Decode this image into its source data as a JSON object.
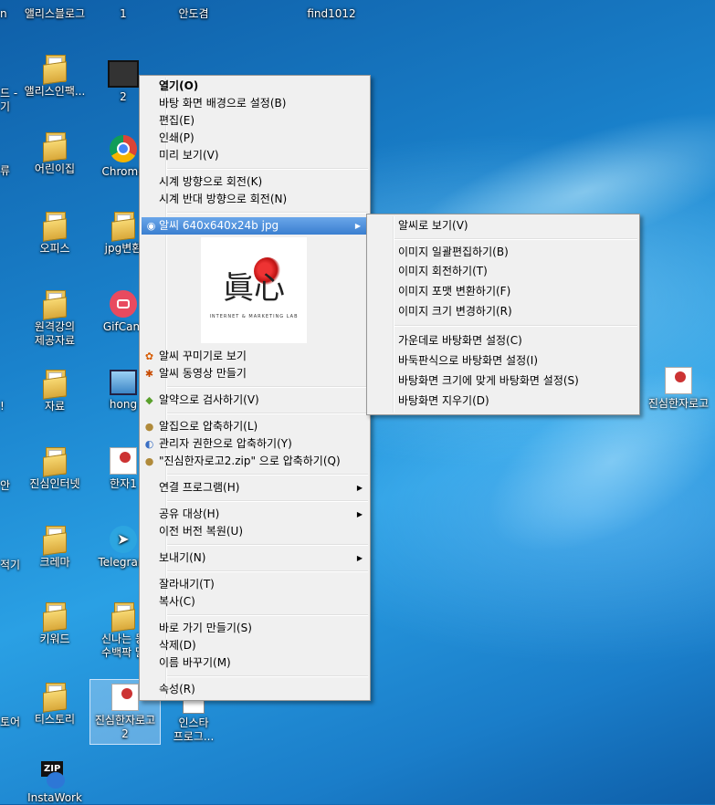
{
  "desktop": {
    "icons": [
      {
        "label": "n",
        "x": 0
      },
      {
        "label": "앨리스블로그"
      },
      {
        "label": "1"
      },
      {
        "label": "안도겸"
      },
      {
        "label": "find1012"
      },
      {
        "label": "드 -"
      },
      {
        "label": "기"
      },
      {
        "label": "앨리스인팩..."
      },
      {
        "label": "2"
      },
      {
        "label": "류"
      },
      {
        "label": "어린이집"
      },
      {
        "label": "Chrome"
      },
      {
        "label": "오피스"
      },
      {
        "label": "jpg변환"
      },
      {
        "label": "원격강의"
      },
      {
        "label": "제공자료"
      },
      {
        "label": "GifCam"
      },
      {
        "label": "자료"
      },
      {
        "label": "hong"
      },
      {
        "label": "!"
      },
      {
        "label": "진심인터넷"
      },
      {
        "label": "한자1"
      },
      {
        "label": "안"
      },
      {
        "label": "크레마"
      },
      {
        "label": "Telegram"
      },
      {
        "label": "적기"
      },
      {
        "label": "키워드"
      },
      {
        "label": "신나는 둥"
      },
      {
        "label": "수백팍 말"
      },
      {
        "label": "토어"
      },
      {
        "label": "티스토리"
      },
      {
        "label": "진심한자로고"
      },
      {
        "label": "2"
      },
      {
        "label": "인스타"
      },
      {
        "label": "프로그..."
      },
      {
        "label": "InstaWork"
      },
      {
        "label": "진심한자로고"
      }
    ]
  },
  "context_menu": {
    "items": [
      {
        "label": "열기(O)",
        "bold": true
      },
      {
        "label": "바탕 화면 배경으로 설정(B)"
      },
      {
        "label": "편집(E)"
      },
      {
        "label": "인쇄(P)"
      },
      {
        "label": "미리 보기(V)"
      },
      {
        "label": "시계 방향으로 회전(K)"
      },
      {
        "label": "시계 반대 방향으로 회전(N)"
      },
      {
        "label": "알씨 640x640x24b jpg"
      },
      {
        "label": "알씨 꾸미기로 보기"
      },
      {
        "label": "알씨 동영상 만들기"
      },
      {
        "label": "알약으로 검사하기(V)"
      },
      {
        "label": "알집으로 압축하기(L)"
      },
      {
        "label": "관리자 권한으로 압축하기(Y)"
      },
      {
        "label": "\"진심한자로고2.zip\" 으로 압축하기(Q)"
      },
      {
        "label": "연결 프로그램(H)"
      },
      {
        "label": "공유 대상(H)"
      },
      {
        "label": "이전 버전 복원(U)"
      },
      {
        "label": "보내기(N)"
      },
      {
        "label": "잘라내기(T)"
      },
      {
        "label": "복사(C)"
      },
      {
        "label": "바로 가기 만들기(S)"
      },
      {
        "label": "삭제(D)"
      },
      {
        "label": "이름 바꾸기(M)"
      },
      {
        "label": "속성(R)"
      }
    ],
    "preview": {
      "logo_text": "眞心",
      "tagline": "INTERNET & MARKETING LAB"
    }
  },
  "submenu": {
    "items": [
      {
        "label": "알씨로 보기(V)"
      },
      {
        "label": "이미지 일괄편집하기(B)"
      },
      {
        "label": "이미지 회전하기(T)"
      },
      {
        "label": "이미지 포맷 변환하기(F)"
      },
      {
        "label": "이미지 크기 변경하기(R)"
      },
      {
        "label": "가운데로 바탕화면 설정(C)"
      },
      {
        "label": "바둑판식으로 바탕화면 설정(I)"
      },
      {
        "label": "바탕화면 크기에 맞게 바탕화면 설정(S)"
      },
      {
        "label": "바탕화면 지우기(D)"
      }
    ]
  },
  "icons": {
    "submenu_arrow": "triangle-right-icon",
    "alsee": "alsee-icon",
    "alsee_decorate": "alsee-decorate-icon",
    "alsee_movie": "alsee-movie-icon",
    "alyac": "alyac-pill-icon",
    "alzip": "alzip-icon",
    "admin_zip": "shield-zip-icon"
  },
  "colors": {
    "highlight": "#3a7fd0",
    "menu_bg": "#f0f0f0",
    "desktop": "#1a82cc"
  }
}
